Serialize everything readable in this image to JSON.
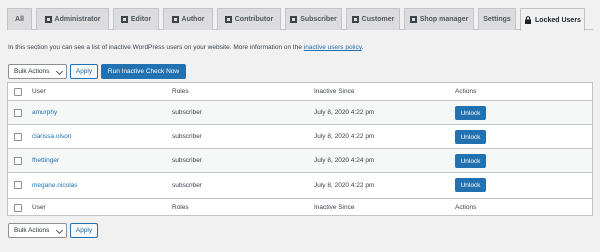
{
  "tabs": [
    {
      "label": "All",
      "icon": "none"
    },
    {
      "label": "Administrator",
      "icon": "list-icon"
    },
    {
      "label": "Editor",
      "icon": "list-icon"
    },
    {
      "label": "Author",
      "icon": "list-icon"
    },
    {
      "label": "Contributor",
      "icon": "list-icon"
    },
    {
      "label": "Subscriber",
      "icon": "list-icon"
    },
    {
      "label": "Customer",
      "icon": "list-icon"
    },
    {
      "label": "Shop manager",
      "icon": "list-icon"
    },
    {
      "label": "Settings",
      "icon": "none"
    },
    {
      "label": "Locked Users",
      "icon": "lock-icon",
      "active": true
    }
  ],
  "intro": {
    "text": "In this section you can see a list of inactive WordPress users on your website. More information on the ",
    "link": "inactive users policy",
    "end": "."
  },
  "top_controls": {
    "bulk_actions": "Bulk Actions",
    "apply": "Apply",
    "run_check": "Run Inactive Check Now"
  },
  "bottom_controls": {
    "bulk_actions": "Bulk Actions",
    "apply": "Apply"
  },
  "table": {
    "columns": [
      "User",
      "Roles",
      "Inactive Since",
      "Actions"
    ],
    "rows": [
      {
        "user": "amurphy",
        "role": "subscriber",
        "since": "July 8, 2020 4:22 pm",
        "action": "Unlock"
      },
      {
        "user": "clarissa.olson",
        "role": "subscriber",
        "since": "July 8, 2020 4:22 pm",
        "action": "Unlock"
      },
      {
        "user": "fhettinger",
        "role": "subscriber",
        "since": "July 8, 2020 4:24 pm",
        "action": "Unlock"
      },
      {
        "user": "megane.nicolas",
        "role": "subscriber",
        "since": "July 8, 2020 4:22 pm",
        "action": "Unlock"
      }
    ]
  },
  "colors": {
    "accent": "#2271b1",
    "tab_bg": "#dcdcde",
    "page_bg": "#f1f1f1"
  }
}
